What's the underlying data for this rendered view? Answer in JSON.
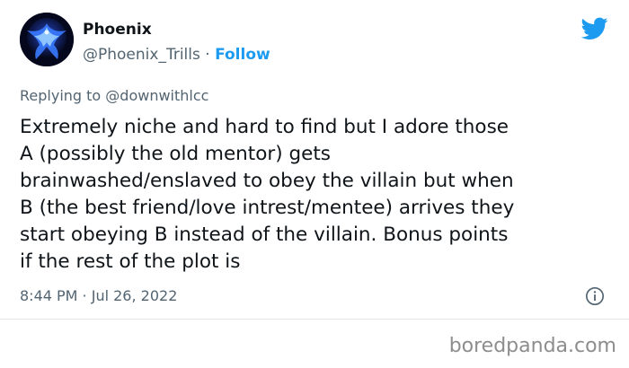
{
  "author": {
    "display_name": "Phoenix",
    "handle": "@Phoenix_Trills",
    "separator": " · ",
    "follow_label": "Follow",
    "avatar_icon": "phoenix-avatar-icon"
  },
  "brand": {
    "logo_icon": "twitter-bird-icon",
    "accent_color": "#1d9bf0"
  },
  "reply": {
    "prefix": "Replying to ",
    "mention": "@downwithlcc"
  },
  "tweet": {
    "lines": [
      "Extremely niche and hard to find but I adore those",
      "A (possibly the old mentor) gets",
      "brainwashed/enslaved to obey the villain but when",
      "B (the best friend/love intrest/mentee) arrives they",
      "start obeying B instead of the villain. Bonus points",
      "if the rest of the plot is"
    ]
  },
  "meta": {
    "timestamp": "8:44 PM · Jul 26, 2022",
    "info_icon": "info-icon"
  },
  "watermark": {
    "text": "boredpanda.com"
  }
}
